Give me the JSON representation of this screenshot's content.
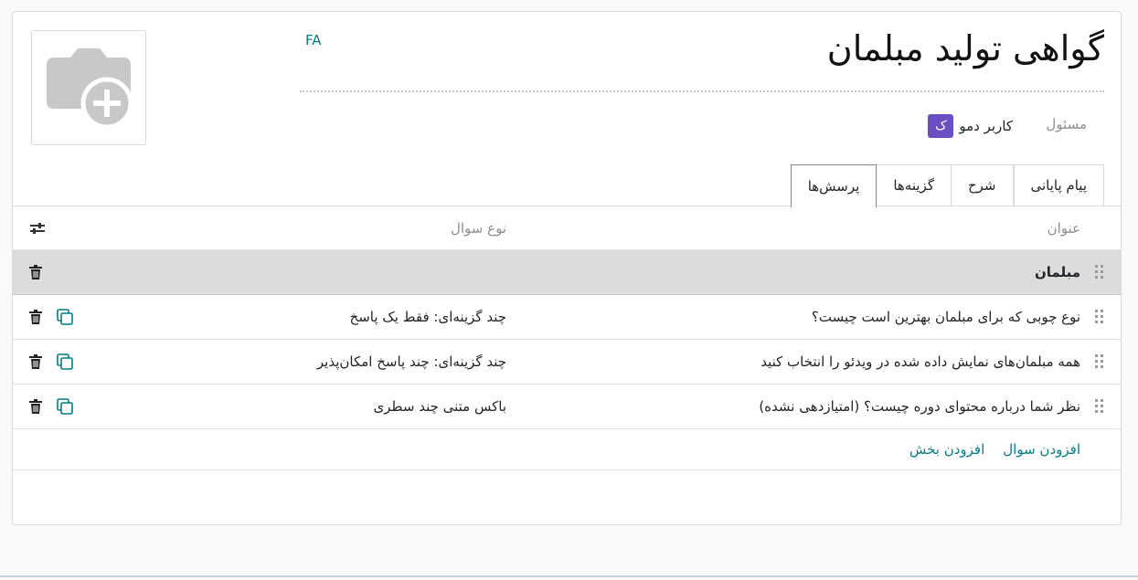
{
  "survey": {
    "title": "گواهی تولید مبلمان",
    "language_badge": "FA",
    "responsible_label": "مسئول",
    "responsible_avatar_letter": "ک",
    "responsible_name": "کاربر دمو",
    "avatar_color": "#6a4fc4",
    "accent_color": "#017e84"
  },
  "tabs": [
    {
      "label": "پرسش‌ها",
      "active": true
    },
    {
      "label": "گزینه‌ها",
      "active": false
    },
    {
      "label": "شرح",
      "active": false
    },
    {
      "label": "پیام پایانی",
      "active": false
    }
  ],
  "table": {
    "headers": {
      "title": "عنوان",
      "question_type": "نوع سوال"
    },
    "section": {
      "title": "مبلمان"
    },
    "rows": [
      {
        "title": "نوع چوبی که برای مبلمان بهترین است چیست؟",
        "type": "چند گزینه‌ای: فقط یک پاسخ"
      },
      {
        "title": "همه مبلمان‌های نمایش داده شده در ویدئو را انتخاب کنید",
        "type": "چند گزینه‌ای: چند پاسخ امکان‌پذیر"
      },
      {
        "title": "نظر شما درباره محتوای دوره چیست؟ (امتیازدهی نشده)",
        "type": "باکس متنی چند سطری"
      }
    ],
    "add_question": "افزودن سوال",
    "add_section": "افزودن بخش"
  },
  "icons": {
    "image_placeholder": "camera-plus-icon",
    "column_settings": "sliders-icon",
    "drag": "drag-handle-icon",
    "delete": "trash-icon",
    "copy": "copy-icon"
  }
}
